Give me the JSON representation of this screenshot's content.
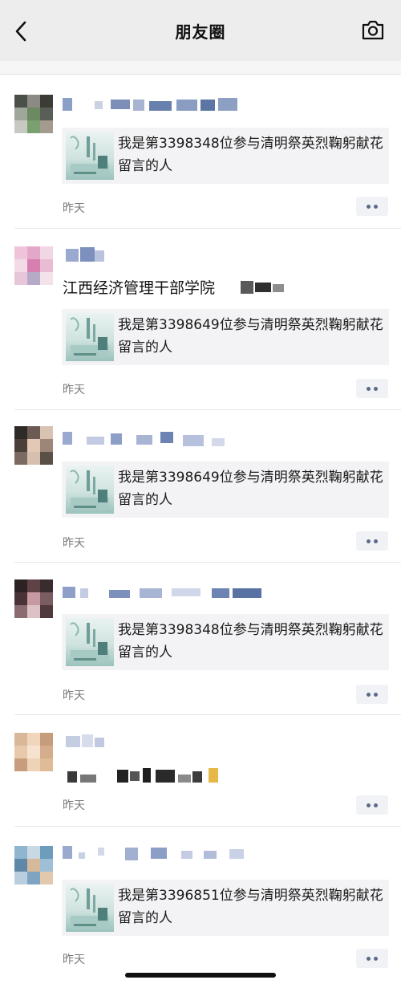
{
  "nav": {
    "title": "朋友圈",
    "back_icon": "back-arrow-icon",
    "camera_icon": "camera-icon",
    "background": "#ededed"
  },
  "posts": [
    {
      "card_text": "我是第3398348位参与清明祭英烈鞠躬献花留言的人",
      "time": "昨天"
    },
    {
      "text": "江西经济管理干部学院",
      "card_text": "我是第3398649位参与清明祭英烈鞠躬献花留言的人",
      "time": "昨天"
    },
    {
      "card_text": "我是第3398649位参与清明祭英烈鞠躬献花留言的人",
      "time": "昨天"
    },
    {
      "card_text": "我是第3398348位参与清明祭英烈鞠躬献花留言的人",
      "time": "昨天"
    },
    {
      "time": "昨天"
    },
    {
      "card_text": "我是第3396851位参与清明祭英烈鞠躬献花留言的人",
      "time": "昨天"
    }
  ],
  "colors": {
    "name_link": "#576b95",
    "time_text": "#7a7a7a",
    "card_bg": "#f3f3f5"
  }
}
